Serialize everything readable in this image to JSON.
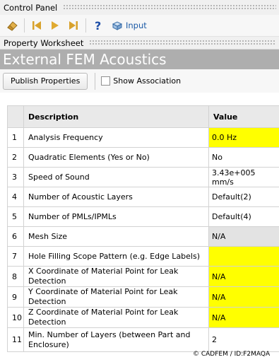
{
  "control_panel": {
    "title": "Control Panel"
  },
  "toolbar": {
    "icons": [
      "eraser-icon",
      "skip-back-icon",
      "play-icon",
      "skip-forward-icon",
      "help-icon",
      "input-icon"
    ],
    "input_label": "Input"
  },
  "worksheet": {
    "title": "Property Worksheet"
  },
  "banner": {
    "title": "External FEM Acoustics"
  },
  "actions": {
    "publish_label": "Publish Properties",
    "show_association_label": "Show Association",
    "show_association_checked": false
  },
  "table": {
    "headers": {
      "description": "Description",
      "value": "Value"
    },
    "rows": [
      {
        "num": "1",
        "desc": "Analysis Frequency",
        "value": "0.0 Hz",
        "bg": "yellow"
      },
      {
        "num": "2",
        "desc": "Quadratic Elements (Yes or No)",
        "value": "No",
        "bg": "white"
      },
      {
        "num": "3",
        "desc": "Speed of Sound",
        "value": "3.43e+005 mm/s",
        "bg": "white"
      },
      {
        "num": "4",
        "desc": "Number of Acoustic Layers",
        "value": "Default(2)",
        "bg": "white"
      },
      {
        "num": "5",
        "desc": "Number of PMLs/IPMLs",
        "value": "Default(4)",
        "bg": "white"
      },
      {
        "num": "6",
        "desc": "Mesh Size",
        "value": "N/A",
        "bg": "grey"
      },
      {
        "num": "7",
        "desc": "Hole Filling Scope Pattern (e.g. Edge Labels)",
        "value": "",
        "bg": "yellow"
      },
      {
        "num": "8",
        "desc": "X Coordinate of Material Point for Leak Detection",
        "value": "N/A",
        "bg": "yellow"
      },
      {
        "num": "9",
        "desc": "Y Coordinate of Material Point for Leak Detection",
        "value": "N/A",
        "bg": "yellow"
      },
      {
        "num": "10",
        "desc": "Z Coordinate of Material Point for Leak Detection",
        "value": "N/A",
        "bg": "yellow"
      },
      {
        "num": "11",
        "desc": "Min. Number of Layers (between Part and Enclosure)",
        "value": "2",
        "bg": "white"
      }
    ]
  },
  "colors": {
    "yellow": "#ffff00",
    "grey": "#e3e3e3",
    "banner": "#aeaeae",
    "link": "#1b5aa6"
  },
  "credit": "© CADFEM / ID:F2MAQA"
}
